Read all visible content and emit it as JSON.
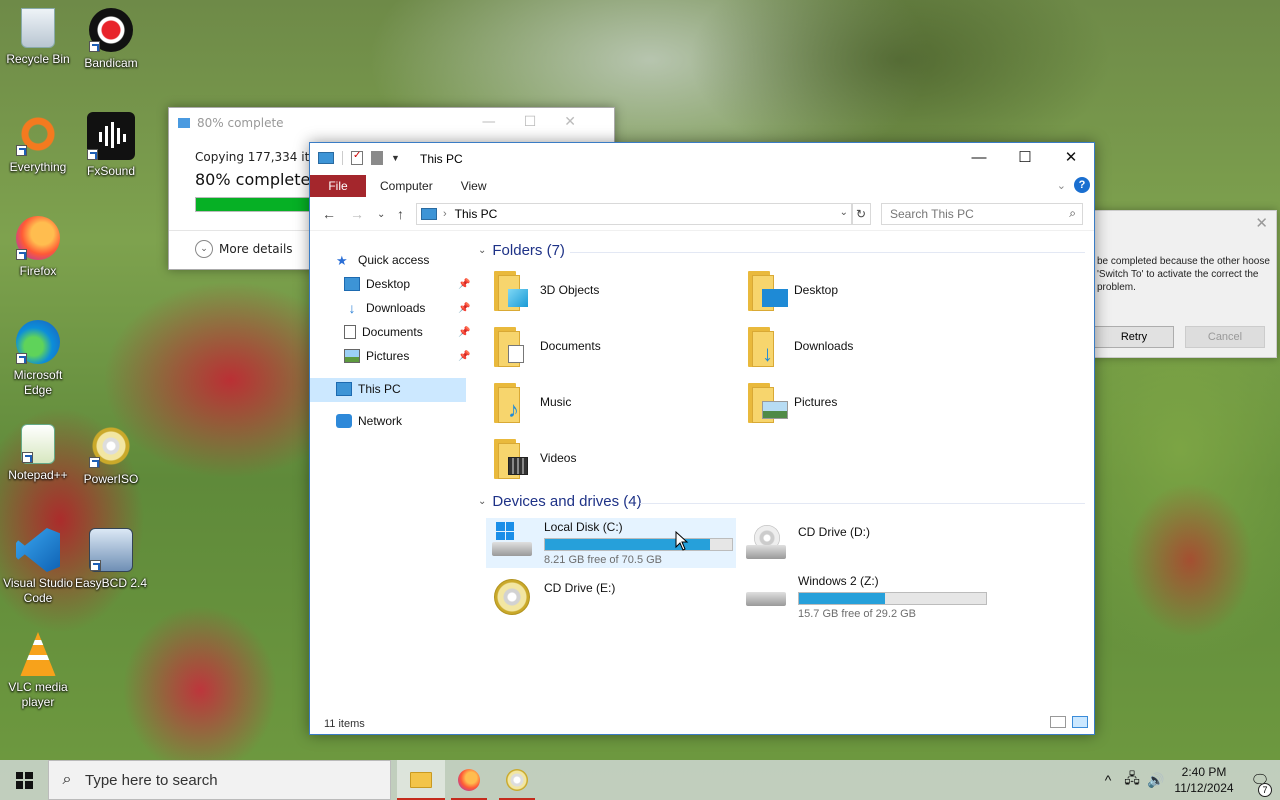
{
  "desktop": {
    "icons": [
      {
        "label": "Recycle Bin"
      },
      {
        "label": "Bandicam"
      },
      {
        "label": "Everything"
      },
      {
        "label": "FxSound"
      },
      {
        "label": "Firefox"
      },
      {
        "label": "Microsoft Edge"
      },
      {
        "label": "Notepad++"
      },
      {
        "label": "PowerISO"
      },
      {
        "label": "Visual Studio Code"
      },
      {
        "label": "EasyBCD 2.4"
      },
      {
        "label": "VLC media player"
      }
    ]
  },
  "copy_dialog": {
    "title": "80% complete",
    "copying_text": "Copying 177,334 item",
    "percent_text": "80% complete",
    "progress": 0.8,
    "more_details": "More details",
    "ctrl_min": "—",
    "ctrl_max": "☐",
    "ctrl_close": "✕"
  },
  "error_dialog": {
    "message": "be completed because the other hoose 'Switch To' to activate the correct the problem.",
    "retry": "Retry",
    "cancel": "Cancel",
    "close": "✕"
  },
  "explorer": {
    "title": "This PC",
    "ctrl_min": "—",
    "ctrl_max": "☐",
    "ctrl_close": "✕",
    "ribbon": {
      "file": "File",
      "computer": "Computer",
      "view": "View",
      "help": "?"
    },
    "address": "This PC",
    "search_placeholder": "Search This PC",
    "nav": {
      "quick_access": "Quick access",
      "desktop": "Desktop",
      "downloads": "Downloads",
      "documents": "Documents",
      "pictures": "Pictures",
      "this_pc": "This PC",
      "network": "Network"
    },
    "folders_header": "Folders (7)",
    "folders": [
      {
        "name": "3D Objects",
        "icon": "3d-objects-icon"
      },
      {
        "name": "Desktop",
        "icon": "desktop-folder-icon"
      },
      {
        "name": "Documents",
        "icon": "documents-folder-icon"
      },
      {
        "name": "Downloads",
        "icon": "downloads-folder-icon"
      },
      {
        "name": "Music",
        "icon": "music-folder-icon"
      },
      {
        "name": "Pictures",
        "icon": "pictures-folder-icon"
      },
      {
        "name": "Videos",
        "icon": "videos-folder-icon"
      }
    ],
    "drives_header": "Devices and drives (4)",
    "drives": [
      {
        "name": "Local Disk (C:)",
        "free": "8.21 GB free of 70.5 GB",
        "used_fraction": 0.884
      },
      {
        "name": "CD Drive (D:)"
      },
      {
        "name": "CD Drive (E:)"
      },
      {
        "name": "Windows 2 (Z:)",
        "free": "15.7 GB free of 29.2 GB",
        "used_fraction": 0.462
      }
    ],
    "status": "11 items"
  },
  "taskbar": {
    "search_placeholder": "Type here to search",
    "time": "2:40 PM",
    "date": "11/12/2024",
    "notification_count": "7",
    "accent": "#c42b1c"
  }
}
